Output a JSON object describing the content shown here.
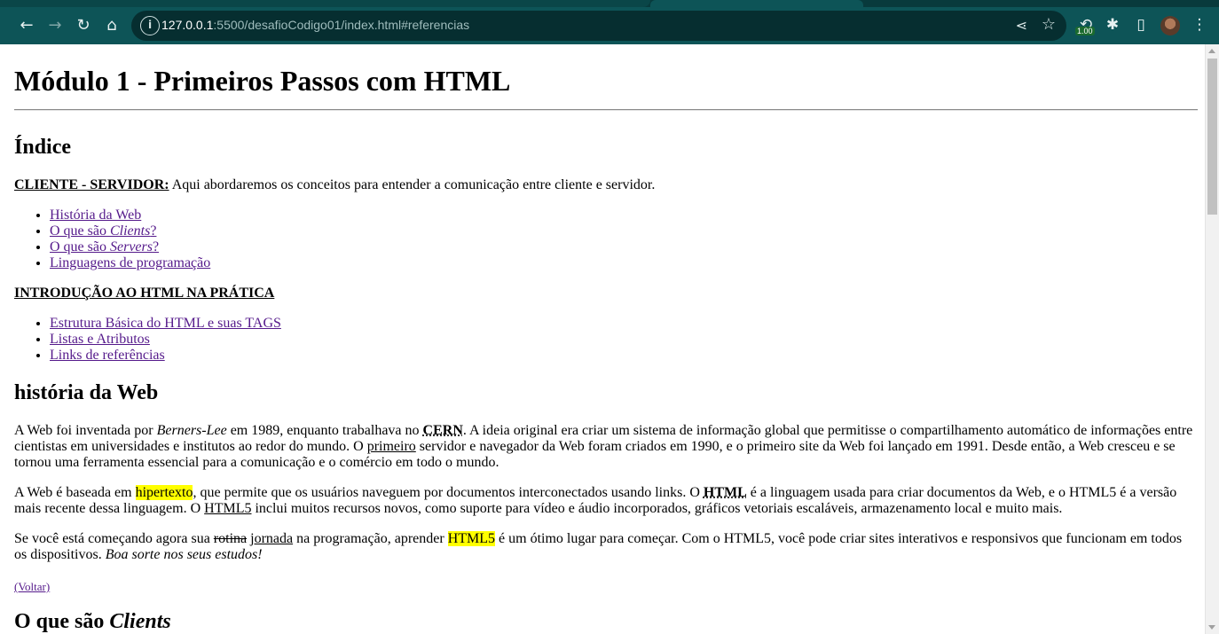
{
  "browser": {
    "url_host": "127.0.0.1",
    "url_rest": ":5500/desafioCodigo01/index.html#referencias",
    "extension_badge": "1.00"
  },
  "page": {
    "title": "Módulo 1 - Primeiros Passos com HTML",
    "index_heading": "Índice",
    "section1_label": "CLIENTE - SERVIDOR:",
    "section1_text": " Aqui abordaremos os conceitos para entender a comunicação entre cliente e servidor.",
    "section1_links": {
      "l1": "História da Web",
      "l2_pre": "O que são ",
      "l2_em": "Clients",
      "l2_post": "?",
      "l3_pre": "O que são ",
      "l3_em": "Servers",
      "l3_post": "?",
      "l4": "Linguagens de programação"
    },
    "section2_label": "INTRODUÇÃO AO HTML NA PRÁTICA",
    "section2_links": [
      "Estrutura Básica do HTML e suas TAGS",
      "Listas e Atributos",
      "Links de referências"
    ],
    "history_heading": "história da Web",
    "p1": {
      "a": "A Web foi inventada por ",
      "em": "Berners-Lee",
      "b": " em 1989, enquanto trabalhava no ",
      "abbr": "CERN",
      "c": ". A ideia original era criar um sistema de informação global que permitisse o compartilhamento automático de informações entre cientistas em universidades e institutos ao redor do mundo. O ",
      "u": "primeiro",
      "d": " servidor e navegador da Web foram criados em 1990, e o primeiro site da Web foi lançado em 1991. Desde então, a Web cresceu e se tornou uma ferramenta essencial para a comunicação e o comércio em todo o mundo."
    },
    "p2": {
      "a": "A Web é baseada em ",
      "mark": "hipertexto",
      "b": ", que permite que os usuários naveguem por documentos interconectados usando links. O ",
      "abbr": "HTML",
      "c": " é a linguagem usada para criar documentos da Web, e o HTML5 é a versão mais recente dessa linguagem. O ",
      "u": "HTML5",
      "d": " inclui muitos recursos novos, como suporte para vídeo e áudio incorporados, gráficos vetoriais escaláveis, armazenamento local e muito mais."
    },
    "p3": {
      "a": "Se você está começando agora sua ",
      "s": "rotina",
      "sp": " ",
      "u": "jornada",
      "b": " na programação, aprender ",
      "mark": "HTML5",
      "c": " é um ótimo lugar para começar. Com o HTML5, você pode criar sites interativos e responsivos que funcionam em todos os dispositivos. ",
      "em": "Boa sorte nos seus estudos!"
    },
    "back_link": "(Voltar)",
    "clients_heading_pre": "O que são ",
    "clients_heading_em": "Clients"
  }
}
